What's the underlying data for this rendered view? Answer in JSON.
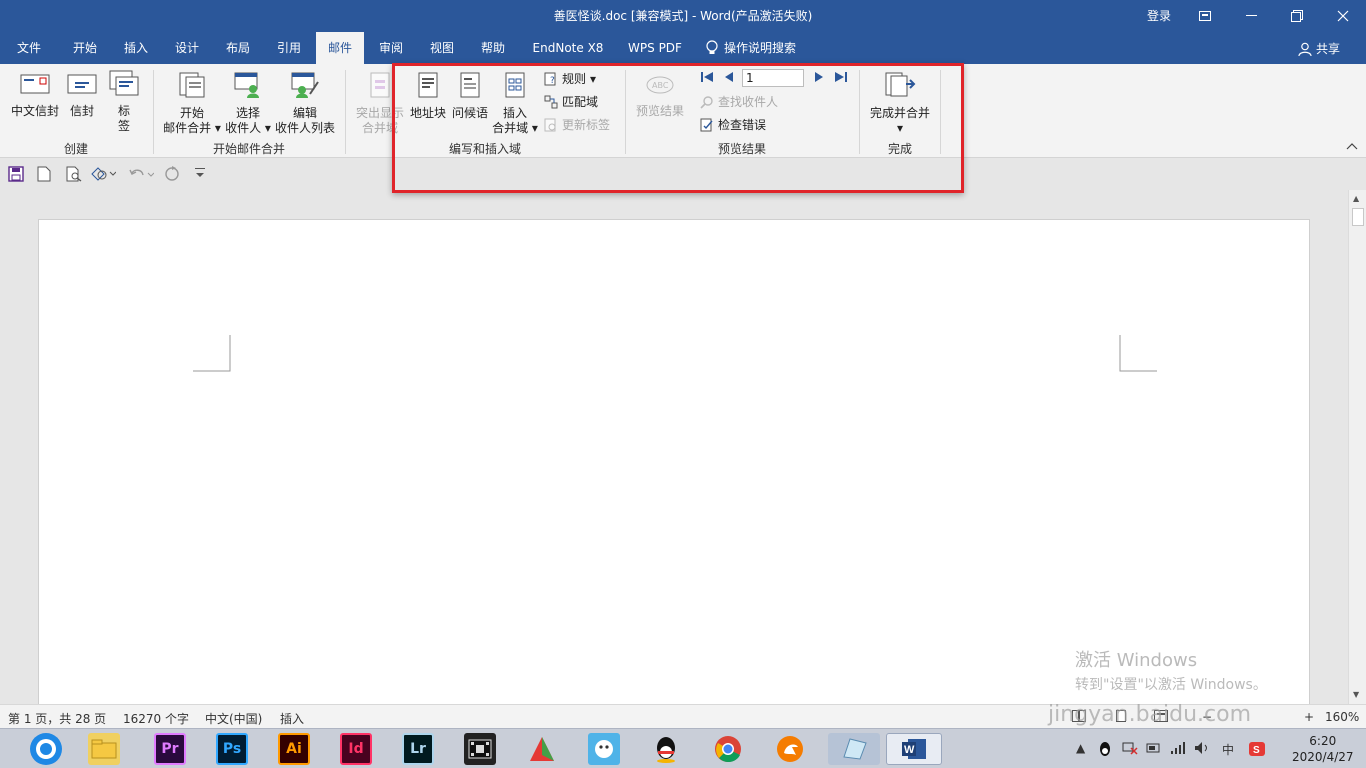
{
  "titlebar": {
    "title": "善医怪谈.doc [兼容模式]  -  Word(产品激活失败)",
    "login": "登录"
  },
  "tabs": [
    "文件",
    "开始",
    "插入",
    "设计",
    "布局",
    "引用",
    "邮件",
    "审阅",
    "视图",
    "帮助",
    "EndNote X8",
    "WPS PDF"
  ],
  "search_tab": "操作说明搜索",
  "share": "共享",
  "ribbon": {
    "create": {
      "btn1": "中文信封",
      "btn2": "信封",
      "btn3a": "标",
      "btn3b": "签",
      "label": "创建"
    },
    "start_merge": {
      "btn1a": "开始",
      "btn1b": "邮件合并",
      "btn2a": "选择",
      "btn2b": "收件人",
      "btn3a": "编辑",
      "btn3b": "收件人列表",
      "label": "开始邮件合并"
    },
    "write_insert": {
      "highlight_a": "突出显示",
      "highlight_b": "合并域",
      "address": "地址块",
      "greeting": "问候语",
      "insert_a": "插入",
      "insert_b": "合并域",
      "rules": "规则",
      "match": "匹配域",
      "update": "更新标签",
      "label": "编写和插入域"
    },
    "preview": {
      "preview_btn": "预览结果",
      "record": "1",
      "find": "查找收件人",
      "check": "检查错误",
      "label": "预览结果"
    },
    "finish": {
      "btn": "完成并合并",
      "label": "完成"
    }
  },
  "status": {
    "page": "第 1 页，共 28 页",
    "words": "16270 个字",
    "lang": "中文(中国)",
    "mode": "插入",
    "zoom": "160%"
  },
  "watermark": {
    "line1": "激活 Windows",
    "line2": "转到\"设置\"以激活 Windows。",
    "site": "jingyan.baidu.com"
  },
  "taskbar": {
    "time": "6:20",
    "date": "2020/4/27",
    "ime": "中",
    "apps": [
      "Pr",
      "Ps",
      "Ai",
      "Id",
      "Lr"
    ]
  },
  "colors": {
    "accent": "#2b579a",
    "highlight_box": "#e0242a"
  }
}
